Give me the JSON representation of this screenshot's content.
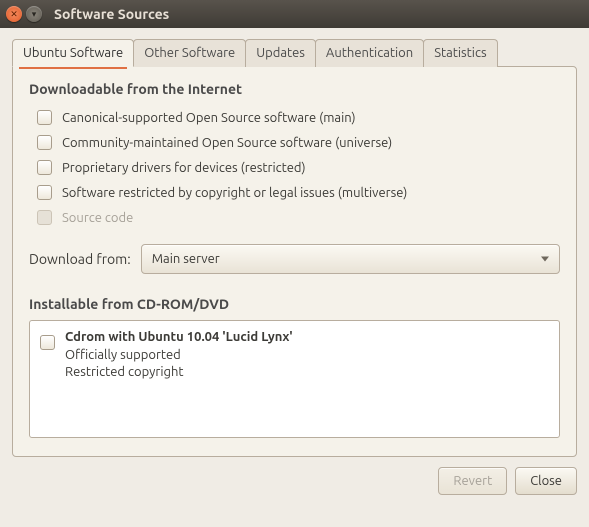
{
  "window": {
    "title": "Software Sources"
  },
  "tabs": [
    {
      "label": "Ubuntu Software",
      "active": true
    },
    {
      "label": "Other Software",
      "active": false
    },
    {
      "label": "Updates",
      "active": false
    },
    {
      "label": "Authentication",
      "active": false
    },
    {
      "label": "Statistics",
      "active": false
    }
  ],
  "internet": {
    "heading": "Downloadable from the Internet",
    "items": [
      {
        "label": "Canonical-supported Open Source software (main)",
        "checked": false,
        "enabled": true
      },
      {
        "label": "Community-maintained Open Source software (universe)",
        "checked": false,
        "enabled": true
      },
      {
        "label": "Proprietary drivers for devices (restricted)",
        "checked": false,
        "enabled": true
      },
      {
        "label": "Software restricted by copyright or legal issues (multiverse)",
        "checked": false,
        "enabled": true
      },
      {
        "label": "Source code",
        "checked": false,
        "enabled": false
      }
    ],
    "download_label": "Download from:",
    "download_selected": "Main server"
  },
  "cdrom": {
    "heading": "Installable from CD-ROM/DVD",
    "items": [
      {
        "title": "Cdrom with Ubuntu 10.04 'Lucid Lynx'",
        "line1": "Officially supported",
        "line2": "Restricted copyright",
        "checked": false
      }
    ]
  },
  "footer": {
    "revert": {
      "label": "Revert",
      "enabled": false
    },
    "close": {
      "label": "Close",
      "enabled": true
    }
  }
}
